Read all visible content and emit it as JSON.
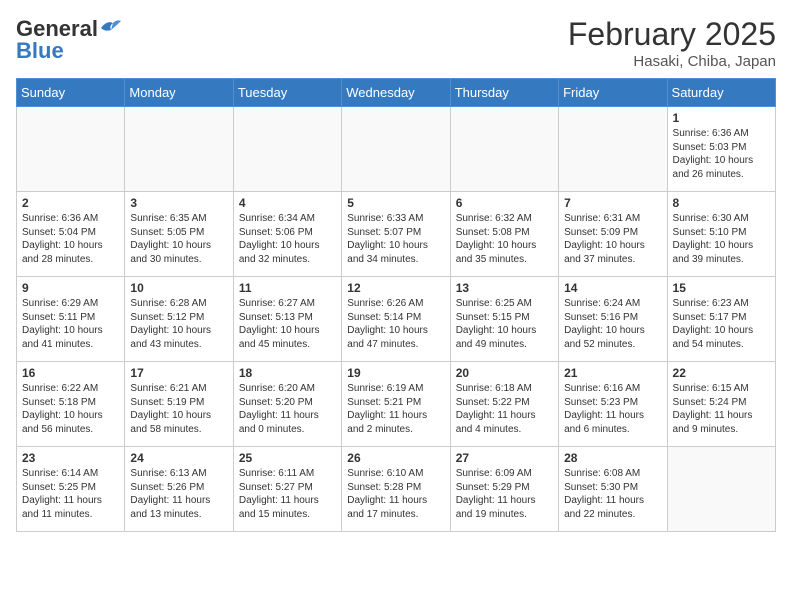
{
  "header": {
    "logo_general": "General",
    "logo_blue": "Blue",
    "month_title": "February 2025",
    "location": "Hasaki, Chiba, Japan"
  },
  "days_of_week": [
    "Sunday",
    "Monday",
    "Tuesday",
    "Wednesday",
    "Thursday",
    "Friday",
    "Saturday"
  ],
  "weeks": [
    [
      {
        "day": "",
        "info": ""
      },
      {
        "day": "",
        "info": ""
      },
      {
        "day": "",
        "info": ""
      },
      {
        "day": "",
        "info": ""
      },
      {
        "day": "",
        "info": ""
      },
      {
        "day": "",
        "info": ""
      },
      {
        "day": "1",
        "info": "Sunrise: 6:36 AM\nSunset: 5:03 PM\nDaylight: 10 hours and 26 minutes."
      }
    ],
    [
      {
        "day": "2",
        "info": "Sunrise: 6:36 AM\nSunset: 5:04 PM\nDaylight: 10 hours and 28 minutes."
      },
      {
        "day": "3",
        "info": "Sunrise: 6:35 AM\nSunset: 5:05 PM\nDaylight: 10 hours and 30 minutes."
      },
      {
        "day": "4",
        "info": "Sunrise: 6:34 AM\nSunset: 5:06 PM\nDaylight: 10 hours and 32 minutes."
      },
      {
        "day": "5",
        "info": "Sunrise: 6:33 AM\nSunset: 5:07 PM\nDaylight: 10 hours and 34 minutes."
      },
      {
        "day": "6",
        "info": "Sunrise: 6:32 AM\nSunset: 5:08 PM\nDaylight: 10 hours and 35 minutes."
      },
      {
        "day": "7",
        "info": "Sunrise: 6:31 AM\nSunset: 5:09 PM\nDaylight: 10 hours and 37 minutes."
      },
      {
        "day": "8",
        "info": "Sunrise: 6:30 AM\nSunset: 5:10 PM\nDaylight: 10 hours and 39 minutes."
      }
    ],
    [
      {
        "day": "9",
        "info": "Sunrise: 6:29 AM\nSunset: 5:11 PM\nDaylight: 10 hours and 41 minutes."
      },
      {
        "day": "10",
        "info": "Sunrise: 6:28 AM\nSunset: 5:12 PM\nDaylight: 10 hours and 43 minutes."
      },
      {
        "day": "11",
        "info": "Sunrise: 6:27 AM\nSunset: 5:13 PM\nDaylight: 10 hours and 45 minutes."
      },
      {
        "day": "12",
        "info": "Sunrise: 6:26 AM\nSunset: 5:14 PM\nDaylight: 10 hours and 47 minutes."
      },
      {
        "day": "13",
        "info": "Sunrise: 6:25 AM\nSunset: 5:15 PM\nDaylight: 10 hours and 49 minutes."
      },
      {
        "day": "14",
        "info": "Sunrise: 6:24 AM\nSunset: 5:16 PM\nDaylight: 10 hours and 52 minutes."
      },
      {
        "day": "15",
        "info": "Sunrise: 6:23 AM\nSunset: 5:17 PM\nDaylight: 10 hours and 54 minutes."
      }
    ],
    [
      {
        "day": "16",
        "info": "Sunrise: 6:22 AM\nSunset: 5:18 PM\nDaylight: 10 hours and 56 minutes."
      },
      {
        "day": "17",
        "info": "Sunrise: 6:21 AM\nSunset: 5:19 PM\nDaylight: 10 hours and 58 minutes."
      },
      {
        "day": "18",
        "info": "Sunrise: 6:20 AM\nSunset: 5:20 PM\nDaylight: 11 hours and 0 minutes."
      },
      {
        "day": "19",
        "info": "Sunrise: 6:19 AM\nSunset: 5:21 PM\nDaylight: 11 hours and 2 minutes."
      },
      {
        "day": "20",
        "info": "Sunrise: 6:18 AM\nSunset: 5:22 PM\nDaylight: 11 hours and 4 minutes."
      },
      {
        "day": "21",
        "info": "Sunrise: 6:16 AM\nSunset: 5:23 PM\nDaylight: 11 hours and 6 minutes."
      },
      {
        "day": "22",
        "info": "Sunrise: 6:15 AM\nSunset: 5:24 PM\nDaylight: 11 hours and 9 minutes."
      }
    ],
    [
      {
        "day": "23",
        "info": "Sunrise: 6:14 AM\nSunset: 5:25 PM\nDaylight: 11 hours and 11 minutes."
      },
      {
        "day": "24",
        "info": "Sunrise: 6:13 AM\nSunset: 5:26 PM\nDaylight: 11 hours and 13 minutes."
      },
      {
        "day": "25",
        "info": "Sunrise: 6:11 AM\nSunset: 5:27 PM\nDaylight: 11 hours and 15 minutes."
      },
      {
        "day": "26",
        "info": "Sunrise: 6:10 AM\nSunset: 5:28 PM\nDaylight: 11 hours and 17 minutes."
      },
      {
        "day": "27",
        "info": "Sunrise: 6:09 AM\nSunset: 5:29 PM\nDaylight: 11 hours and 19 minutes."
      },
      {
        "day": "28",
        "info": "Sunrise: 6:08 AM\nSunset: 5:30 PM\nDaylight: 11 hours and 22 minutes."
      },
      {
        "day": "",
        "info": ""
      }
    ]
  ]
}
